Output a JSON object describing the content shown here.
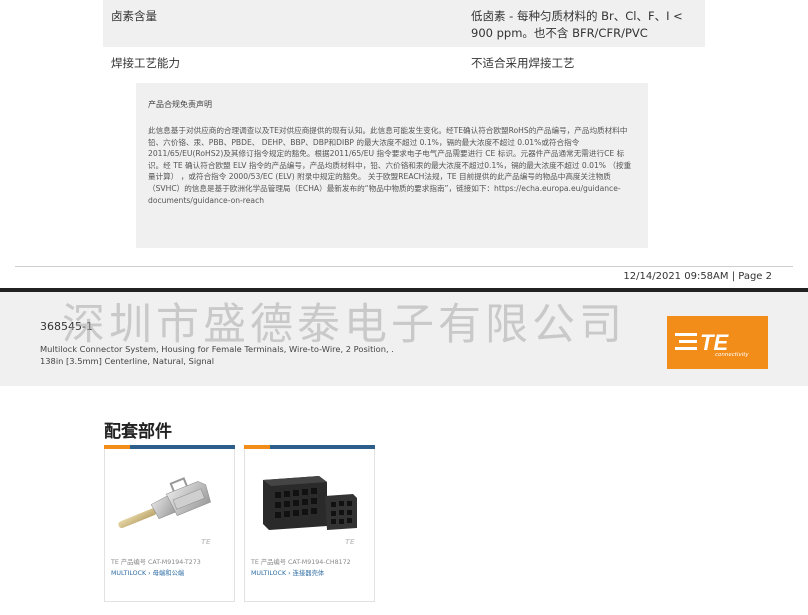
{
  "spec_rows": [
    {
      "label": "卤素含量",
      "value": "低卤素 - 每种匀质材料的 Br、Cl、F、I < 900 ppm。也不含 BFR/CFR/PVC"
    },
    {
      "label": "焊接工艺能力",
      "value": "不适合采用焊接工艺"
    }
  ],
  "disclaimer": {
    "title": "产品合规免责声明",
    "body": "此信息基于对供应商的合理调查以及TE对供应商提供的现有认知。此信息可能发生变化。经TE确认符合欧盟RoHS的产品编号，产品均质材料中铅、六价铬、汞、PBB、PBDE、 DEHP、BBP、DBP和DIBP 的最大浓度不超过 0.1%，镉的最大浓度不超过 0.01%或符合指令2011/65/EU(RoHS2)及其修订指令规定的豁免。根据2011/65/EU 指令要求电子电气产品需要进行 CE 标识。元器件产品通常无需进行CE 标识。经 TE 确认符合欧盟 ELV 指令的产品编号，产品均质材料中，铅、六价铬和汞的最大浓度不超过0.1%，镉的最大浓度不超过 0.01% （按重量计算） ，或符合指令 2000/53/EC (ELV) 附录中规定的豁免。 关于欧盟REACH法规，TE 目前提供的此产品编号的物品中高度关注物质（SVHC）的信息是基于欧洲化学品管理局（ECHA）最新发布的“物品中物质的要求指南”，链接如下：https://echa.europa.eu/guidance-documents/guidance-on-reach"
  },
  "page_footer": "12/14/2021 09:58AM | Page 2",
  "header": {
    "part_number": "368545-1",
    "description_line1": "Multilock Connector System, Housing for Female Terminals, Wire-to-Wire, 2 Position, .",
    "description_line2": "138in [3.5mm] Centerline, Natural, Signal",
    "watermark": "深圳市盛德泰电子有限公司",
    "logo_text": "TE",
    "logo_subtext": "connectivity"
  },
  "section_title": "配套部件",
  "cards": [
    {
      "part_no": "TE 产品编号  CAT-M9194-T273",
      "link": "MULTILOCK › 母端和公端"
    },
    {
      "part_no": "TE 产品编号  CAT-M9194-CH8172",
      "link": "MULTILOCK › 连接器壳体"
    }
  ],
  "colors": {
    "accent": "#f28d1a",
    "link": "#2e6da4",
    "card_bar": "#2e5f8c"
  }
}
